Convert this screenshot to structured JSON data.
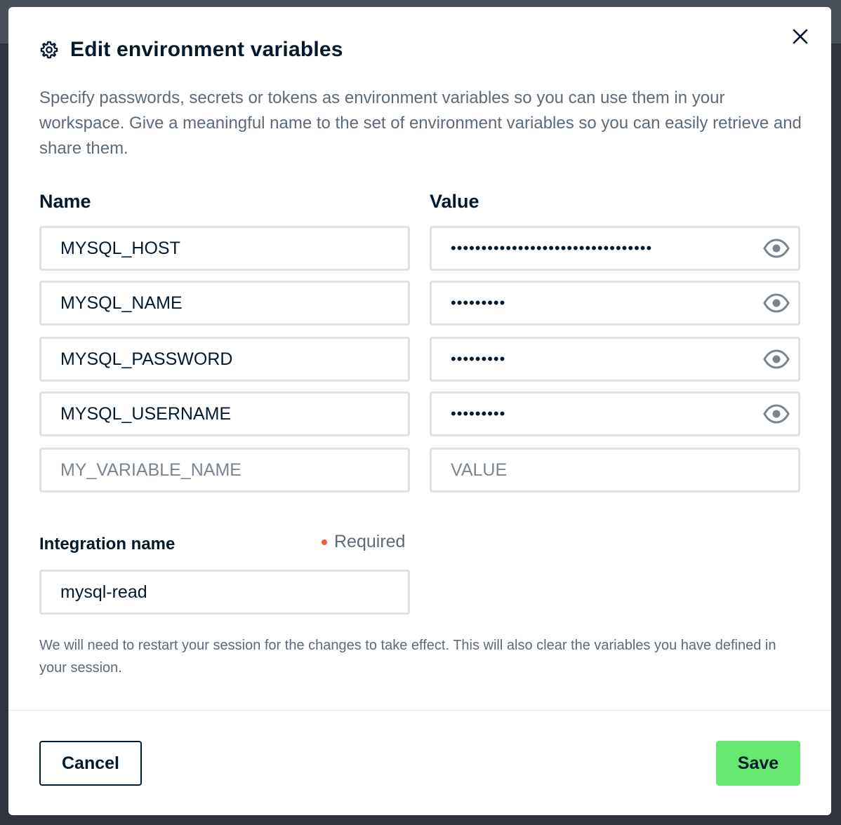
{
  "dialog": {
    "title": "Edit environment variables",
    "description": "Specify passwords, secrets or tokens as environment variables so you can use them in your workspace. Give a meaningful name to the set of environment variables so you can easily retrieve and share them."
  },
  "columns": {
    "name_label": "Name",
    "value_label": "Value"
  },
  "variables": [
    {
      "name": "MYSQL_HOST",
      "masked_value": "•••••••••••••••••••••••••••••••••"
    },
    {
      "name": "MYSQL_NAME",
      "masked_value": "•••••••••"
    },
    {
      "name": "MYSQL_PASSWORD",
      "masked_value": "•••••••••"
    },
    {
      "name": "MYSQL_USERNAME",
      "masked_value": "•••••••••"
    }
  ],
  "new_variable": {
    "name_placeholder": "MY_VARIABLE_NAME",
    "value_placeholder": "VALUE"
  },
  "integration": {
    "label": "Integration name",
    "required_text": "Required",
    "value": "mysql-read"
  },
  "note": "We will need to restart your session for the changes to take effect. This will also clear the variables you have defined in your session.",
  "footer": {
    "cancel_label": "Cancel",
    "save_label": "Save"
  },
  "colors": {
    "primary_text": "#05192d",
    "secondary_text": "#5d6a77",
    "save_button": "#65e970",
    "required_dot": "#f35e2e",
    "field_border": "#e5e1da"
  },
  "icons": {
    "header": "gear-icon",
    "close": "close-icon",
    "reveal": "eye-icon"
  }
}
